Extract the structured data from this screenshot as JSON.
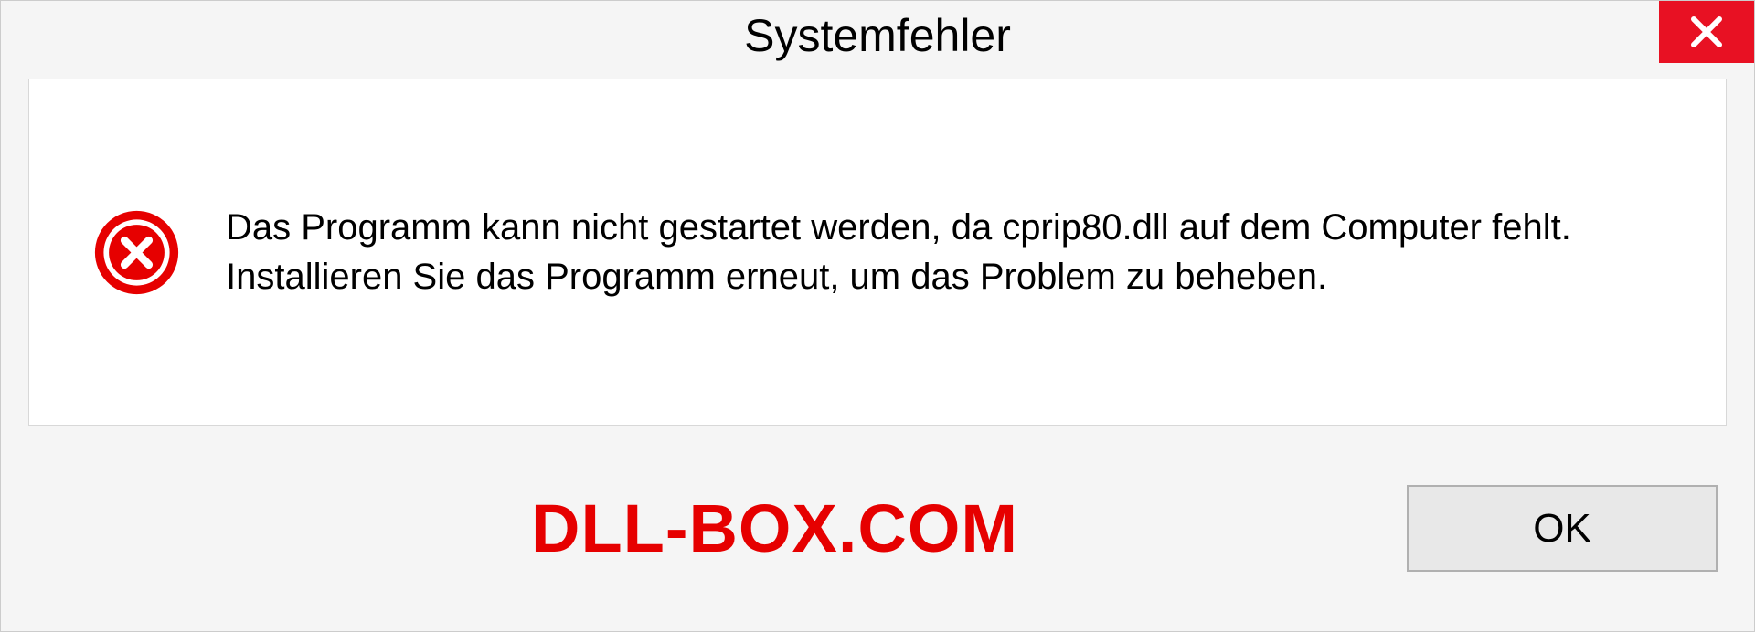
{
  "dialog": {
    "title": "Systemfehler",
    "message": "Das Programm kann nicht gestartet werden, da cprip80.dll auf dem Computer fehlt. Installieren Sie das Programm erneut, um das Problem zu beheben.",
    "ok_label": "OK"
  },
  "watermark": "DLL-BOX.COM",
  "colors": {
    "close_bg": "#e81123",
    "error_icon": "#e60000",
    "watermark": "#e60000"
  }
}
